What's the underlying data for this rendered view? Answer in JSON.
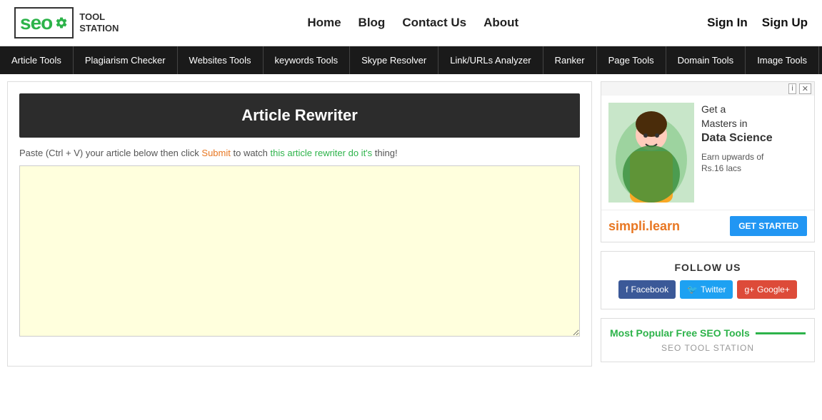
{
  "header": {
    "logo": {
      "seo_text": "seo",
      "tool_text": "TOOL\nSTATION"
    },
    "nav": {
      "home": "Home",
      "blog": "Blog",
      "contact": "Contact Us",
      "about": "About"
    },
    "auth": {
      "signin": "Sign In",
      "signup": "Sign Up"
    }
  },
  "toolbar": {
    "items": [
      "Article Tools",
      "Plagiarism Checker",
      "Websites Tools",
      "keywords Tools",
      "Skype Resolver",
      "Link/URLs Analyzer",
      "Ranker",
      "Page Tools",
      "Domain Tools",
      "Image Tools"
    ]
  },
  "main": {
    "title": "Article Rewriter",
    "instructions": {
      "prefix": "Paste (Ctrl + V) your article below then click ",
      "submit": "Submit",
      "middle": " to watch ",
      "watch_text": "this article rewriter do",
      "its": " it's",
      "thing": " thing!"
    },
    "textarea_placeholder": ""
  },
  "sidebar": {
    "ad": {
      "title_line1": "Get a",
      "title_line2": "Masters in",
      "title_bold": "Data Science",
      "earn_text": "Earn upwards of",
      "earn_amount": "Rs.16 lacs",
      "brand": "simpli.learn",
      "cta": "GET STARTED"
    },
    "follow": {
      "title": "FOLLOW US",
      "facebook": "Facebook",
      "twitter": "Twitter",
      "google": "Google+"
    },
    "popular": {
      "title": "Most Popular Free SEO Tools",
      "subtitle": "SEO TOOL STATION"
    }
  }
}
